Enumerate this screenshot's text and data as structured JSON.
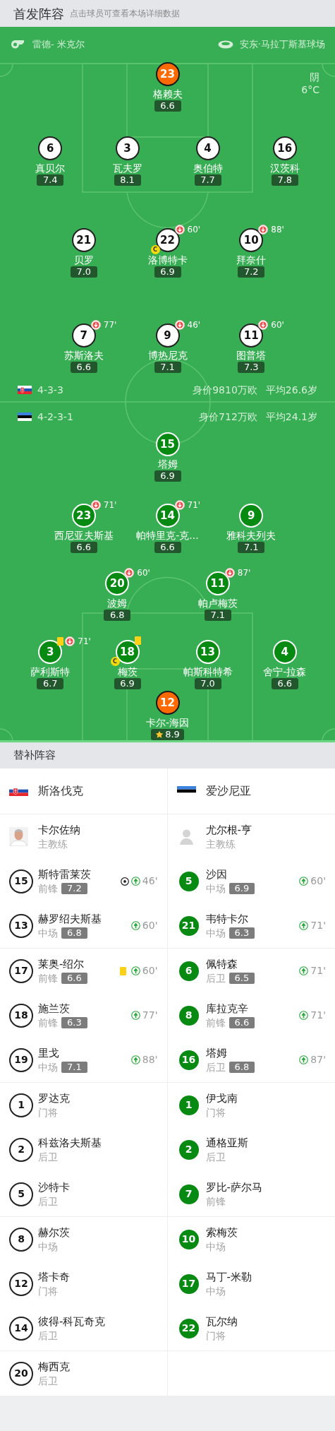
{
  "lineup": {
    "title": "首发阵容",
    "hint": "点击球员可查看本场详细数据",
    "referee": "雷德- 米克尔",
    "stadium": "安东·马拉丁斯基球场",
    "weather": "阴",
    "temperature": "6°C",
    "teams": [
      {
        "kind": "sk",
        "color": "#ffffff",
        "formation": "4-3-3",
        "market_value": "身价9810万欧",
        "average_age": "平均26.6岁",
        "lines": [
          [
            {
              "number": "23",
              "name": "格赖夫",
              "rating": "6.6",
              "kind": "goalkeeper",
              "captain": false,
              "yellow_card": false,
              "best": false
            }
          ],
          [
            {
              "number": "6",
              "name": "真贝尔",
              "rating": "7.4",
              "kind": "outfield",
              "captain": false,
              "yellow_card": false,
              "best": false
            },
            {
              "number": "3",
              "name": "瓦夫罗",
              "rating": "8.1",
              "kind": "outfield",
              "captain": false,
              "yellow_card": false,
              "best": false
            },
            {
              "number": "4",
              "name": "奥伯特",
              "rating": "7.7",
              "kind": "outfield",
              "captain": false,
              "yellow_card": false,
              "best": false
            },
            {
              "number": "16",
              "name": "汉茨科",
              "rating": "7.8",
              "kind": "outfield",
              "captain": false,
              "yellow_card": false,
              "best": false
            }
          ],
          [
            {
              "number": "21",
              "name": "贝罗",
              "rating": "7.0",
              "kind": "outfield",
              "captain": false,
              "yellow_card": false,
              "best": false
            },
            {
              "number": "22",
              "name": "洛博特卡",
              "rating": "6.9",
              "kind": "outfield",
              "captain": true,
              "captain_label": "C",
              "yellow_card": false,
              "best": false,
              "sub_off": "60'"
            },
            {
              "number": "10",
              "name": "拜奈什",
              "rating": "7.2",
              "kind": "outfield",
              "captain": false,
              "yellow_card": false,
              "best": false,
              "sub_off": "88'"
            }
          ],
          [
            {
              "number": "7",
              "name": "苏斯洛夫",
              "rating": "6.6",
              "kind": "outfield",
              "captain": false,
              "yellow_card": false,
              "best": false,
              "sub_off": "77'"
            },
            {
              "number": "9",
              "name": "博热尼克",
              "rating": "7.1",
              "kind": "outfield",
              "captain": false,
              "yellow_card": false,
              "best": false,
              "sub_off": "46'"
            },
            {
              "number": "11",
              "name": "图普塔",
              "rating": "7.3",
              "kind": "outfield",
              "captain": false,
              "yellow_card": false,
              "best": false,
              "sub_off": "60'"
            }
          ]
        ]
      },
      {
        "kind": "ee",
        "color": "#078a12",
        "formation": "4-2-3-1",
        "market_value": "身价712万欧",
        "average_age": "平均24.1岁",
        "lines": [
          [
            {
              "number": "15",
              "name": "塔姆",
              "rating": "6.9",
              "kind": "outfield",
              "captain": false,
              "yellow_card": false,
              "best": false
            }
          ],
          [
            {
              "number": "23",
              "name": "西尼亚夫斯基",
              "rating": "6.6",
              "kind": "outfield",
              "captain": false,
              "yellow_card": false,
              "best": false,
              "sub_off": "71'"
            },
            {
              "number": "14",
              "name": "帕特里克-克...",
              "rating": "6.6",
              "kind": "outfield",
              "captain": false,
              "yellow_card": false,
              "best": false,
              "sub_off": "71'"
            },
            {
              "number": "9",
              "name": "雅科夫列夫",
              "rating": "7.1",
              "kind": "outfield",
              "captain": false,
              "yellow_card": false,
              "best": false
            }
          ],
          [
            {
              "number": "20",
              "name": "波姆",
              "rating": "6.8",
              "kind": "outfield",
              "captain": false,
              "yellow_card": false,
              "best": false,
              "sub_off": "60'"
            },
            {
              "number": "11",
              "name": "帕卢梅茨",
              "rating": "7.1",
              "kind": "outfield",
              "captain": false,
              "yellow_card": false,
              "best": false,
              "sub_off": "87'"
            }
          ],
          [
            {
              "number": "3",
              "name": "萨利斯特",
              "rating": "6.7",
              "kind": "outfield",
              "captain": false,
              "yellow_card": true,
              "best": false,
              "sub_off": "71'"
            },
            {
              "number": "18",
              "name": "梅茨",
              "rating": "6.9",
              "kind": "outfield",
              "captain": true,
              "captain_label": "C",
              "yellow_card": true,
              "best": false
            },
            {
              "number": "13",
              "name": "帕斯科特希",
              "rating": "7.0",
              "kind": "outfield",
              "captain": false,
              "yellow_card": false,
              "best": false
            },
            {
              "number": "4",
              "name": "舍宁-拉森",
              "rating": "6.6",
              "kind": "outfield",
              "captain": false,
              "yellow_card": false,
              "best": false
            }
          ],
          [
            {
              "number": "12",
              "name": "卡尔-海因",
              "rating": "8.9",
              "kind": "goalkeeper",
              "captain": false,
              "yellow_card": false,
              "best": true
            }
          ]
        ]
      }
    ]
  },
  "bench": {
    "title": "替补阵容",
    "teams": [
      {
        "kind": "sk",
        "color": "#ffffff",
        "name": "斯洛伐克",
        "coach": {
          "name": "卡尔佐纳",
          "role": "主教练",
          "photo": true
        },
        "players": [
          {
            "number": "15",
            "name": "斯特雷莱茨",
            "position": "前锋",
            "rating": "7.2",
            "goal": true,
            "yellow_card": false,
            "sub_on": "46'"
          },
          {
            "number": "13",
            "name": "赫罗绍夫斯基",
            "position": "中场",
            "rating": "6.8",
            "goal": false,
            "yellow_card": false,
            "sub_on": "60'"
          },
          {
            "number": "17",
            "name": "莱奥-绍尔",
            "position": "前锋",
            "rating": "6.6",
            "goal": false,
            "yellow_card": true,
            "sub_on": "60'"
          },
          {
            "number": "18",
            "name": "施兰茨",
            "position": "前锋",
            "rating": "6.3",
            "goal": false,
            "yellow_card": false,
            "sub_on": "77'"
          },
          {
            "number": "19",
            "name": "里戈",
            "position": "中场",
            "rating": "7.1",
            "goal": false,
            "yellow_card": false,
            "sub_on": "88'"
          },
          {
            "number": "1",
            "name": "罗达克",
            "position": "门将",
            "goal": false,
            "yellow_card": false
          },
          {
            "number": "2",
            "name": "科兹洛夫斯基",
            "position": "后卫",
            "goal": false,
            "yellow_card": false
          },
          {
            "number": "5",
            "name": "沙特卡",
            "position": "后卫",
            "goal": false,
            "yellow_card": false
          },
          {
            "number": "8",
            "name": "赫尔茨",
            "position": "中场",
            "goal": false,
            "yellow_card": false
          },
          {
            "number": "12",
            "name": "塔卡奇",
            "position": "门将",
            "goal": false,
            "yellow_card": false
          },
          {
            "number": "14",
            "name": "彼得-科瓦奇克",
            "position": "后卫",
            "goal": false,
            "yellow_card": false
          },
          {
            "number": "20",
            "name": "梅西克",
            "position": "后卫",
            "goal": false,
            "yellow_card": false
          }
        ]
      },
      {
        "kind": "ee",
        "color": "#078a12",
        "name": "爱沙尼亚",
        "coach": {
          "name": "尤尔根-亨",
          "role": "主教练",
          "photo": false
        },
        "players": [
          {
            "number": "5",
            "name": "沙因",
            "position": "中场",
            "rating": "6.9",
            "goal": false,
            "yellow_card": false,
            "sub_on": "60'"
          },
          {
            "number": "21",
            "name": "韦特卡尔",
            "position": "中场",
            "rating": "6.3",
            "goal": false,
            "yellow_card": false,
            "sub_on": "71'"
          },
          {
            "number": "6",
            "name": "佩特森",
            "position": "后卫",
            "rating": "6.5",
            "goal": false,
            "yellow_card": false,
            "sub_on": "71'"
          },
          {
            "number": "8",
            "name": "库拉克辛",
            "position": "前锋",
            "rating": "6.6",
            "goal": false,
            "yellow_card": false,
            "sub_on": "71'"
          },
          {
            "number": "16",
            "name": "塔姆",
            "position": "后卫",
            "rating": "6.8",
            "goal": false,
            "yellow_card": false,
            "sub_on": "87'"
          },
          {
            "number": "1",
            "name": "伊戈南",
            "position": "门将",
            "goal": false,
            "yellow_card": false
          },
          {
            "number": "2",
            "name": "通格亚斯",
            "position": "后卫",
            "goal": false,
            "yellow_card": false
          },
          {
            "number": "7",
            "name": "罗比-萨尔马",
            "position": "前锋",
            "goal": false,
            "yellow_card": false
          },
          {
            "number": "10",
            "name": "索梅茨",
            "position": "中场",
            "goal": false,
            "yellow_card": false
          },
          {
            "number": "17",
            "name": "马丁-米勒",
            "position": "中场",
            "goal": false,
            "yellow_card": false
          },
          {
            "number": "22",
            "name": "瓦尔纳",
            "position": "门将",
            "goal": false,
            "yellow_card": false
          }
        ]
      }
    ]
  }
}
